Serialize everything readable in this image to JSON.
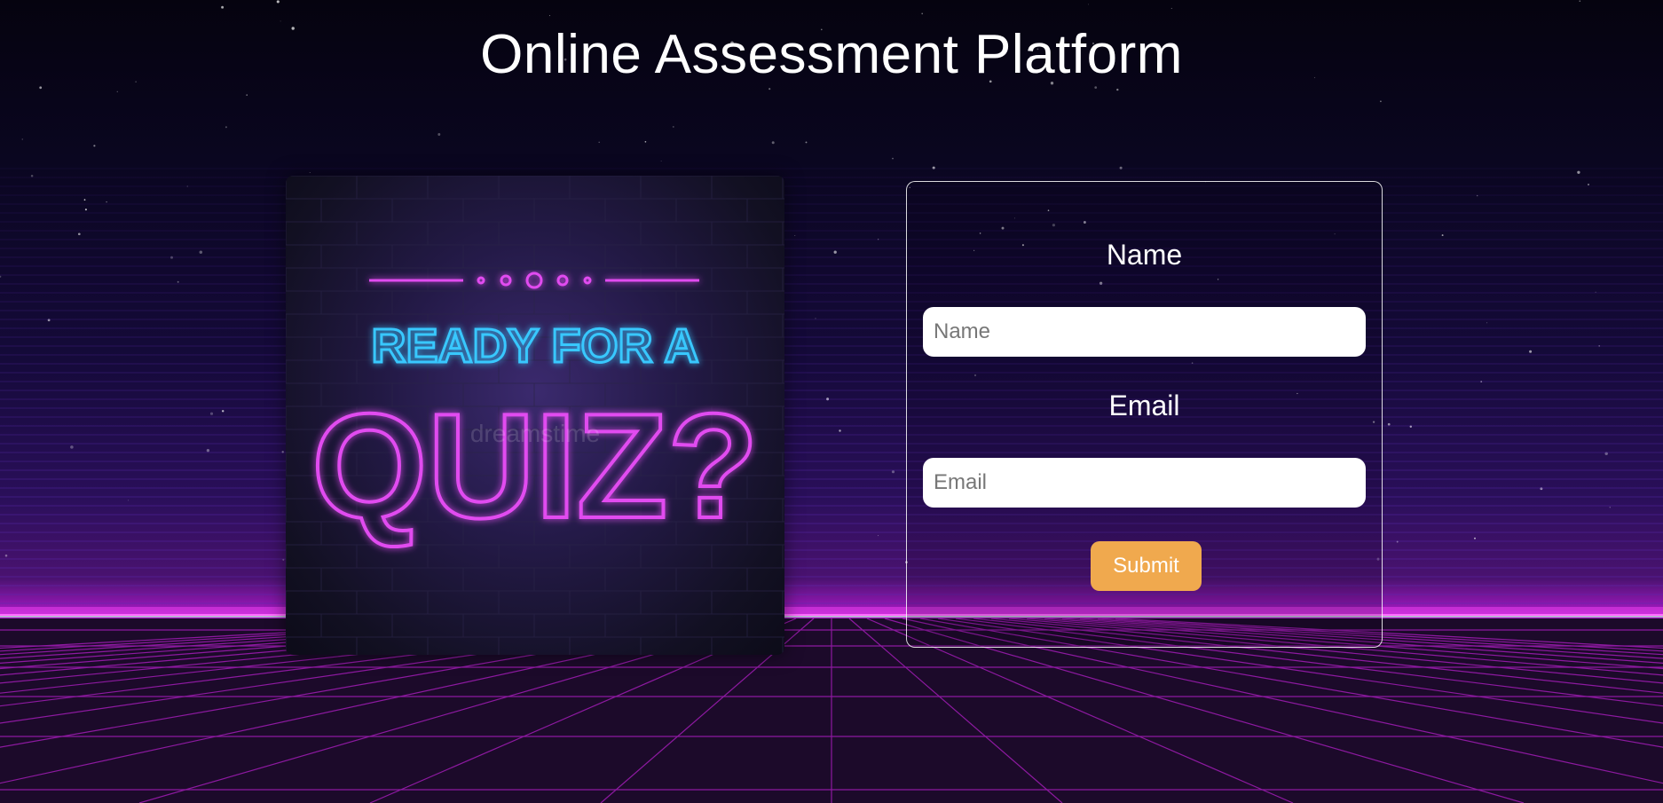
{
  "header": {
    "title": "Online Assessment Platform"
  },
  "hero_image": {
    "line1": "READY FOR A",
    "line2": "QUIZ?",
    "watermark": "dreamstime"
  },
  "form": {
    "name_label": "Name",
    "name_placeholder": "Name",
    "email_label": "Email",
    "email_placeholder": "Email",
    "submit_label": "Submit"
  },
  "colors": {
    "accent": "#f0a94e",
    "neon_pink": "#e14cf0",
    "neon_blue": "#38c8ff"
  }
}
